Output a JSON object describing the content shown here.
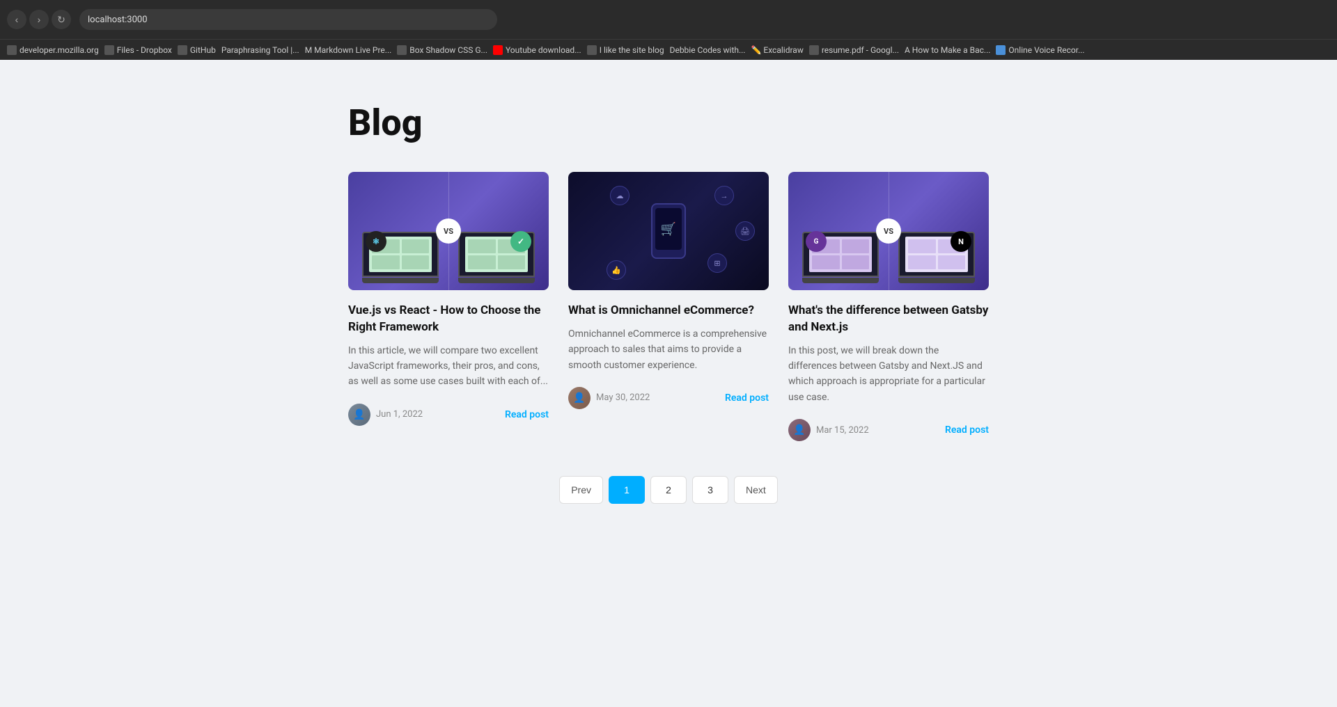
{
  "browser": {
    "url": "localhost:3000",
    "bookmarks": [
      {
        "label": "developer.mozilla.org",
        "icon": "🌐"
      },
      {
        "label": "Files - Dropbox",
        "icon": "📦"
      },
      {
        "label": "GitHub",
        "icon": "🐙"
      },
      {
        "label": "Paraphrasing Tool |...",
        "icon": "📝"
      },
      {
        "label": "Markdown Live Pre...",
        "icon": "M"
      },
      {
        "label": "Box Shadow CSS G...",
        "icon": "📦"
      },
      {
        "label": "Youtube download...",
        "icon": "▶"
      },
      {
        "label": "I like the site blog",
        "icon": "🔖"
      },
      {
        "label": "Debbie Codes with...",
        "icon": "🔖"
      },
      {
        "label": "Excalidraw",
        "icon": "✏️"
      },
      {
        "label": "resume.pdf - Googl...",
        "icon": "📄"
      },
      {
        "label": "How to Make a Bac...",
        "icon": "A"
      },
      {
        "label": "Online Voice Recor...",
        "icon": "🎤"
      }
    ]
  },
  "page": {
    "title": "Blog"
  },
  "posts": [
    {
      "id": 1,
      "title": "Vue.js vs React - How to Choose the Right Framework",
      "excerpt": "In this article, we will compare two excellent JavaScript frameworks, their pros, and cons, as well as some use cases built with each of...",
      "author_date": "Jun 1, 2022",
      "read_label": "Read post",
      "image_type": "vuereact"
    },
    {
      "id": 2,
      "title": "What is Omnichannel eCommerce?",
      "excerpt": "Omnichannel eCommerce is a comprehensive approach to sales that aims to provide a smooth customer experience.",
      "author_date": "May 30, 2022",
      "read_label": "Read post",
      "image_type": "omni"
    },
    {
      "id": 3,
      "title": "What's the difference between Gatsby and Next.js",
      "excerpt": "In this post, we will break down the differences between Gatsby and Next.JS and which approach is appropriate for a particular use case.",
      "author_date": "Mar 15, 2022",
      "read_label": "Read post",
      "image_type": "gatsby"
    }
  ],
  "pagination": {
    "prev_label": "Prev",
    "next_label": "Next",
    "pages": [
      "1",
      "2",
      "3"
    ],
    "active_page": "1"
  }
}
